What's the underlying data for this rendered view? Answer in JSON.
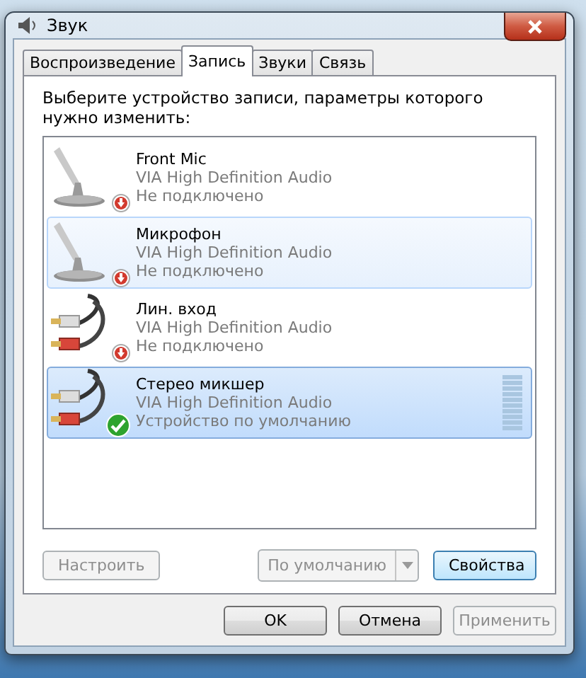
{
  "window": {
    "title": "Звук"
  },
  "tabs": [
    {
      "label": "Воспроизведение",
      "selected": false
    },
    {
      "label": "Запись",
      "selected": true
    },
    {
      "label": "Звуки",
      "selected": false
    },
    {
      "label": "Связь",
      "selected": false
    }
  ],
  "instruction": "Выберите устройство записи, параметры которого нужно изменить:",
  "devices": [
    {
      "kind": "mic",
      "name": "Front Mic",
      "driver": "VIA High Definition Audio",
      "status_text": "Не подключено",
      "connected": false,
      "selected": false,
      "highlighted": false
    },
    {
      "kind": "mic",
      "name": "Микрофон",
      "driver": "VIA High Definition Audio",
      "status_text": "Не подключено",
      "connected": false,
      "selected": false,
      "highlighted": true
    },
    {
      "kind": "jack",
      "name": "Лин. вход",
      "driver": "VIA High Definition Audio",
      "status_text": "Не подключено",
      "connected": false,
      "selected": false,
      "highlighted": false
    },
    {
      "kind": "jack",
      "name": "Стерео микшер",
      "driver": "VIA High Definition Audio",
      "status_text": "Устройство по умолчанию",
      "connected": true,
      "selected": true,
      "highlighted": false
    }
  ],
  "panel_buttons": {
    "configure": {
      "label": "Настроить",
      "disabled": true
    },
    "set_default": {
      "label": "По умолчанию",
      "disabled": true
    },
    "properties": {
      "label": "Свойства",
      "disabled": false
    }
  },
  "dialog_buttons": [
    {
      "label": "OK",
      "disabled": false
    },
    {
      "label": "Отмена",
      "disabled": false
    },
    {
      "label": "Применить",
      "disabled": true
    }
  ]
}
